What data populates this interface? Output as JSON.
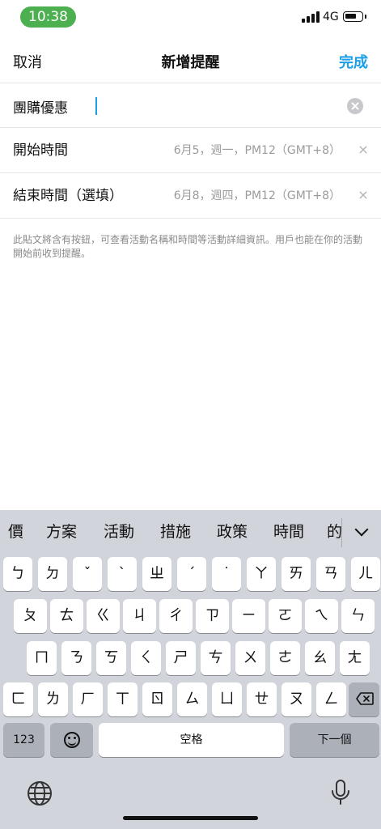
{
  "status_bar": {
    "time": "10:38",
    "network": "4G"
  },
  "nav": {
    "cancel": "取消",
    "title": "新增提醒",
    "done": "完成"
  },
  "form": {
    "title_value": "團購優惠",
    "start_label": "開始時間",
    "start_value": "6月5，週一，PM12（GMT+8）",
    "end_label": "結束時間（選填）",
    "end_value": "6月8，週四，PM12（GMT+8）",
    "clear_glyph": "×",
    "help_text": "此貼文將含有按鈕，可查看活動名稱和時間等活動詳細資訊。用戶也能在你的活動開始前收到提醒。"
  },
  "keyboard": {
    "candidates": [
      "價",
      "方案",
      "活動",
      "措施",
      "政策",
      "時間",
      "的"
    ],
    "row1": [
      "ㄅ",
      "ㄉ",
      "ˇ",
      "ˋ",
      "ㄓ",
      "ˊ",
      "˙",
      "ㄚ",
      "ㄞ",
      "ㄢ",
      "ㄦ"
    ],
    "row2": [
      "ㄆ",
      "ㄊ",
      "ㄍ",
      "ㄐ",
      "ㄔ",
      "ㄗ",
      "ㄧ",
      "ㄛ",
      "ㄟ",
      "ㄣ"
    ],
    "row3": [
      "ㄇ",
      "ㄋ",
      "ㄎ",
      "ㄑ",
      "ㄕ",
      "ㄘ",
      "ㄨ",
      "ㄜ",
      "ㄠ",
      "ㄤ"
    ],
    "row4": [
      "ㄈ",
      "ㄌ",
      "ㄏ",
      "ㄒ",
      "ㄖ",
      "ㄙ",
      "ㄩ",
      "ㄝ",
      "ㄡ",
      "ㄥ"
    ],
    "mode_key": "123",
    "space": "空格",
    "next": "下一個"
  },
  "icons": [
    "signal-icon",
    "battery-icon",
    "clear-icon",
    "close-icon",
    "chevron-down-icon",
    "backspace-icon",
    "emoji-icon",
    "globe-icon",
    "microphone-icon"
  ],
  "colors": {
    "accent": "#1a9fe8",
    "time_pill": "#4caf50",
    "keyboard_bg": "#d1d4da"
  }
}
